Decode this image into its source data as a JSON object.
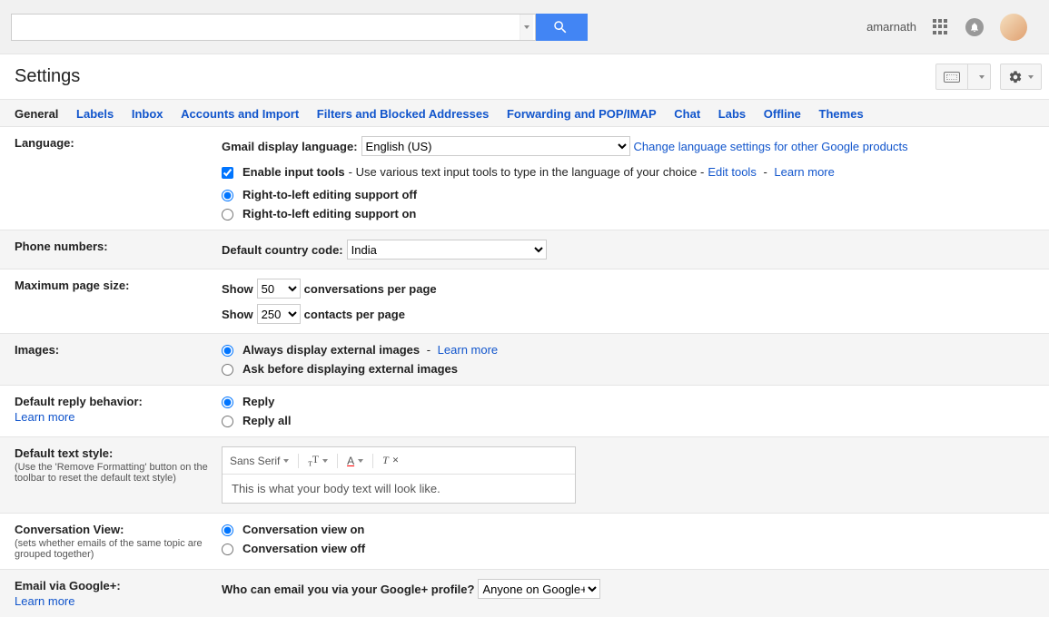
{
  "header": {
    "username": "amarnath",
    "page_title": "Settings"
  },
  "tabs": [
    "General",
    "Labels",
    "Inbox",
    "Accounts and Import",
    "Filters and Blocked Addresses",
    "Forwarding and POP/IMAP",
    "Chat",
    "Labs",
    "Offline",
    "Themes"
  ],
  "language": {
    "label": "Language:",
    "display_label": "Gmail display language:",
    "display_value": "English (US)",
    "change_link": "Change language settings for other Google products",
    "enable_input_label": "Enable input tools",
    "enable_input_desc": " - Use various text input tools to type in the language of your choice - ",
    "edit_tools": "Edit tools",
    "learn_more": "Learn more",
    "rtl_off": "Right-to-left editing support off",
    "rtl_on": "Right-to-left editing support on"
  },
  "phone": {
    "label": "Phone numbers:",
    "default_label": "Default country code:",
    "default_value": "India"
  },
  "pagesize": {
    "label": "Maximum page size:",
    "show": "Show",
    "conv_value": "50",
    "conv_text": "conversations per page",
    "cont_value": "250",
    "cont_text": "contacts per page"
  },
  "images": {
    "label": "Images:",
    "always": "Always display external images",
    "learn": "Learn more",
    "ask": "Ask before displaying external images"
  },
  "reply": {
    "label": "Default reply behavior:",
    "learn": "Learn more",
    "reply": "Reply",
    "replyall": "Reply all"
  },
  "textstyle": {
    "label": "Default text style:",
    "sub": "(Use the 'Remove Formatting' button on the toolbar to reset the default text style)",
    "font": "Sans Serif",
    "size_glyph": "тТ",
    "preview": "This is what your body text will look like."
  },
  "conversation": {
    "label": "Conversation View:",
    "sub": "(sets whether emails of the same topic are grouped together)",
    "on": "Conversation view on",
    "off": "Conversation view off"
  },
  "gplus": {
    "label": "Email via Google+:",
    "learn": "Learn more",
    "question": "Who can email you via your Google+ profile?",
    "value": "Anyone on Google+"
  }
}
